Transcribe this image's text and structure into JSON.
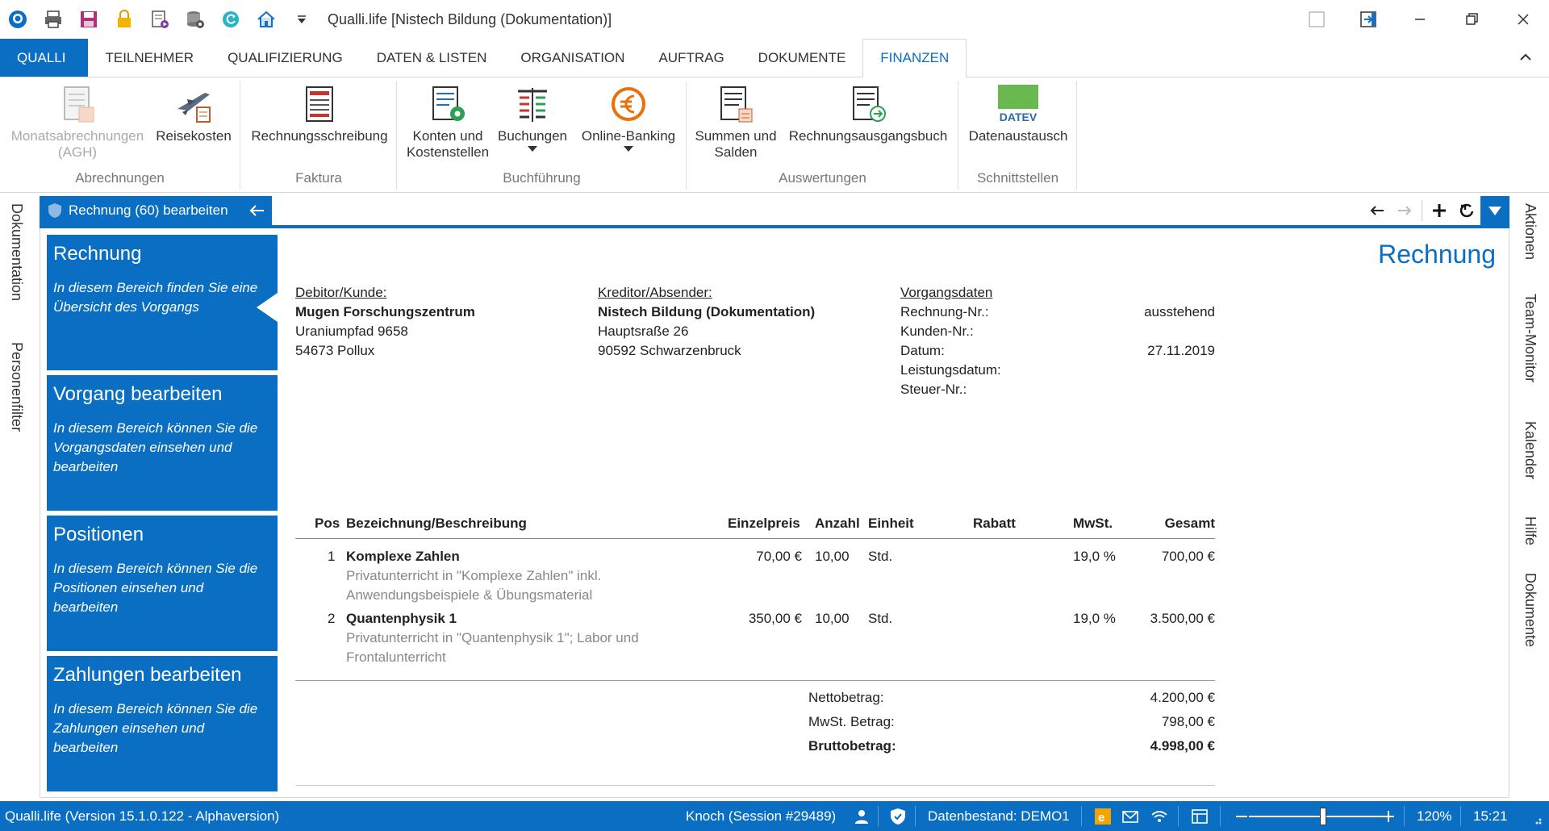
{
  "window": {
    "title": "Qualli.life [Nistech Bildung (Dokumentation)]"
  },
  "menu": {
    "tabs": [
      {
        "label": "QUALLI"
      },
      {
        "label": "TEILNEHMER"
      },
      {
        "label": "QUALIFIZIERUNG"
      },
      {
        "label": "DATEN & LISTEN"
      },
      {
        "label": "ORGANISATION"
      },
      {
        "label": "AUFTRAG"
      },
      {
        "label": "DOKUMENTE"
      },
      {
        "label": "FINANZEN"
      }
    ]
  },
  "ribbon": {
    "groups": {
      "abrechnungen": "Abrechnungen",
      "faktura": "Faktura",
      "buchfuehrung": "Buchführung",
      "auswertungen": "Auswertungen",
      "schnittstellen": "Schnittstellen"
    },
    "buttons": {
      "monatsabrechnungen_1": "Monatsabrechnungen",
      "monatsabrechnungen_2": "(AGH)",
      "reisekosten": "Reisekosten",
      "rechnungsschreibung": "Rechnungsschreibung",
      "konten_1": "Konten und",
      "konten_2": "Kostenstellen",
      "buchungen": "Buchungen",
      "online_banking": "Online-Banking",
      "summen_1": "Summen und",
      "summen_2": "Salden",
      "rechnungsausgangsbuch": "Rechnungsausgangsbuch",
      "datenaustausch": "Datenaustausch",
      "datev_logo": "DATEV"
    }
  },
  "side_left": {
    "items": [
      "Dokumentation",
      "Personenfilter"
    ]
  },
  "side_right": {
    "items": [
      "Aktionen",
      "Team-Monitor",
      "Kalender",
      "Hilfe",
      "Dokumente"
    ]
  },
  "doc_tab": {
    "label": "Rechnung (60) bearbeiten"
  },
  "sections": [
    {
      "title": "Rechnung",
      "desc": "In diesem Bereich finden Sie eine Übersicht des Vorgangs"
    },
    {
      "title": "Vorgang bearbeiten",
      "desc": "In diesem Bereich können Sie die Vorgangsdaten einsehen und bearbeiten"
    },
    {
      "title": "Positionen",
      "desc": "In diesem Bereich können Sie die Positionen einsehen und bearbeiten"
    },
    {
      "title": "Zahlungen bearbeiten",
      "desc": "In diesem Bereich können Sie die Zahlungen einsehen und bearbeiten"
    }
  ],
  "invoice": {
    "heading": "Rechnung",
    "debitor": {
      "label": "Debitor/Kunde:",
      "name": "Mugen Forschungszentrum",
      "street": "Uraniumpfad 9658",
      "city": "54673 Pollux"
    },
    "kreditor": {
      "label": "Kreditor/Absender:",
      "name": "Nistech Bildung (Dokumentation)",
      "street": "Hauptsraße 26",
      "city": "90592 Schwarzenbruck"
    },
    "vorgang": {
      "label": "Vorgangsdaten",
      "rechnung_nr_label": "Rechnung-Nr.:",
      "rechnung_nr_value": "ausstehend",
      "kunden_nr_label": "Kunden-Nr.:",
      "datum_label": "Datum:",
      "datum_value": "27.11.2019",
      "leistungsdatum_label": "Leistungsdatum:",
      "steuer_nr_label": "Steuer-Nr.:"
    },
    "columns": {
      "pos": "Pos",
      "bezeichnung": "Bezeichnung/Beschreibung",
      "einzelpreis": "Einzelpreis",
      "anzahl": "Anzahl",
      "einheit": "Einheit",
      "rabatt": "Rabatt",
      "mwst": "MwSt.",
      "gesamt": "Gesamt"
    },
    "rows": [
      {
        "pos": "1",
        "title": "Komplexe Zahlen",
        "desc_1": "Privatunterricht in \"Komplexe Zahlen\" inkl.",
        "desc_2": "Anwendungsbeispiele & Übungsmaterial",
        "einzelpreis": "70,00 €",
        "anzahl": "10,00",
        "einheit": "Std.",
        "mwst": "19,0 %",
        "gesamt": "700,00 €"
      },
      {
        "pos": "2",
        "title": "Quantenphysik 1",
        "desc_1": "Privatunterricht in \"Quantenphysik 1\"; Labor und",
        "desc_2": "Frontalunterricht",
        "einzelpreis": "350,00 €",
        "anzahl": "10,00",
        "einheit": "Std.",
        "mwst": "19,0 %",
        "gesamt": "3.500,00 €"
      }
    ],
    "totals": {
      "netto_label": "Nettobetrag:",
      "netto_value": "4.200,00 €",
      "mwst_label": "MwSt. Betrag:",
      "mwst_value": "798,00 €",
      "brutto_label": "Bruttobetrag:",
      "brutto_value": "4.998,00 €"
    }
  },
  "statusbar": {
    "version": "Qualli.life (Version 15.1.0.122 - Alphaversion)",
    "session": "Knoch (Session #29489)",
    "datenbestand": "Datenbestand: DEMO1",
    "zoom": "120%",
    "zoom_fraction": 0.55,
    "time": "15:21"
  },
  "colors": {
    "accent": "#0a6fc2"
  }
}
